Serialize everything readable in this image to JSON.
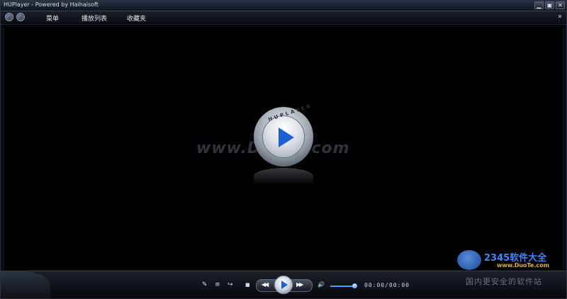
{
  "window": {
    "title": "HUPlayer - Powered by Haihaisoft",
    "buttons": {
      "minimize": "▁",
      "maximize": "▣",
      "close": "✕"
    }
  },
  "menubar": {
    "back_icon": "‹",
    "forward_icon": "›",
    "items": [
      "菜单",
      "播放列表",
      "收藏夹"
    ],
    "more_icon": "»"
  },
  "video": {
    "watermark": "www.DuoTe.com",
    "logo_text": "HUPLAYER"
  },
  "controls": {
    "icons": {
      "tools": "✎",
      "playlist": "≡",
      "repeat": "↪",
      "stop": "■",
      "rewind": "◀◀",
      "fast_forward": "▶▶",
      "volume": "🔊"
    },
    "volume_level": 0.9,
    "time": "00:00/00:00"
  },
  "site_logo": {
    "number": "2345软件大全",
    "url": "www.DuoTe.com",
    "chinese": "国内更安全的软件站"
  },
  "colors": {
    "accent": "#1f5fd6",
    "volume_fill": "#4f9cff",
    "background": "#000000"
  }
}
